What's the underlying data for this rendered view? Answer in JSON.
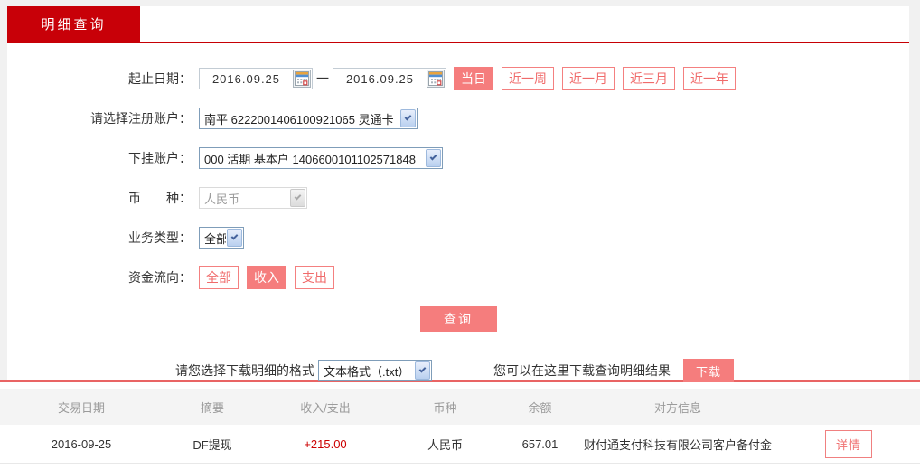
{
  "window": {
    "tab_label": "明细查询"
  },
  "form": {
    "date_range": {
      "label": "起止日期：",
      "start_date": "2016.09.25",
      "end_date": "2016.09.25",
      "separator": "一",
      "quick_ranges": [
        {
          "label": "当日",
          "active": true
        },
        {
          "label": "近一周",
          "active": false
        },
        {
          "label": "近一月",
          "active": false
        },
        {
          "label": "近三月",
          "active": false
        },
        {
          "label": "近一年",
          "active": false
        }
      ]
    },
    "register_account": {
      "label": "请选择注册账户：",
      "value": "南平 6222001406100921065 灵通卡"
    },
    "sub_account": {
      "label": "下挂账户：",
      "value": "000 活期 基本户 1406600101102571848"
    },
    "currency": {
      "label": "币　　种：",
      "value": "人民币",
      "disabled": true
    },
    "business_type": {
      "label": "业务类型：",
      "value": "全部"
    },
    "fund_direction": {
      "label": "资金流向：",
      "options": [
        {
          "label": "全部",
          "active": false
        },
        {
          "label": "收入",
          "active": true
        },
        {
          "label": "支出",
          "active": false
        }
      ]
    },
    "query_button_label": "查询"
  },
  "download": {
    "format_label": "请您选择下载明细的格式",
    "format_value": "文本格式（.txt）",
    "hint": "您可以在这里下载查询明细结果",
    "button_label": "下载"
  },
  "table": {
    "headers": [
      "交易日期",
      "摘要",
      "收入/支出",
      "币种",
      "余额",
      "对方信息"
    ],
    "rows": [
      {
        "trade_date": "2016-09-25",
        "summary": "DF提现",
        "amount": "+215.00",
        "currency": "人民币",
        "balance": "657.01",
        "counterparty": "财付通支付科技有限公司客户备付金",
        "action_label": "详情"
      }
    ]
  },
  "colors": {
    "tab_red": "#c80008",
    "accent_salmon": "#f57d7d",
    "accent_border": "#f08080",
    "amount_red": "#cc0000",
    "divider_red": "#e96464",
    "page_margin_gray": "#f1f1f1",
    "table_header_gray": "#f4f4f4"
  }
}
